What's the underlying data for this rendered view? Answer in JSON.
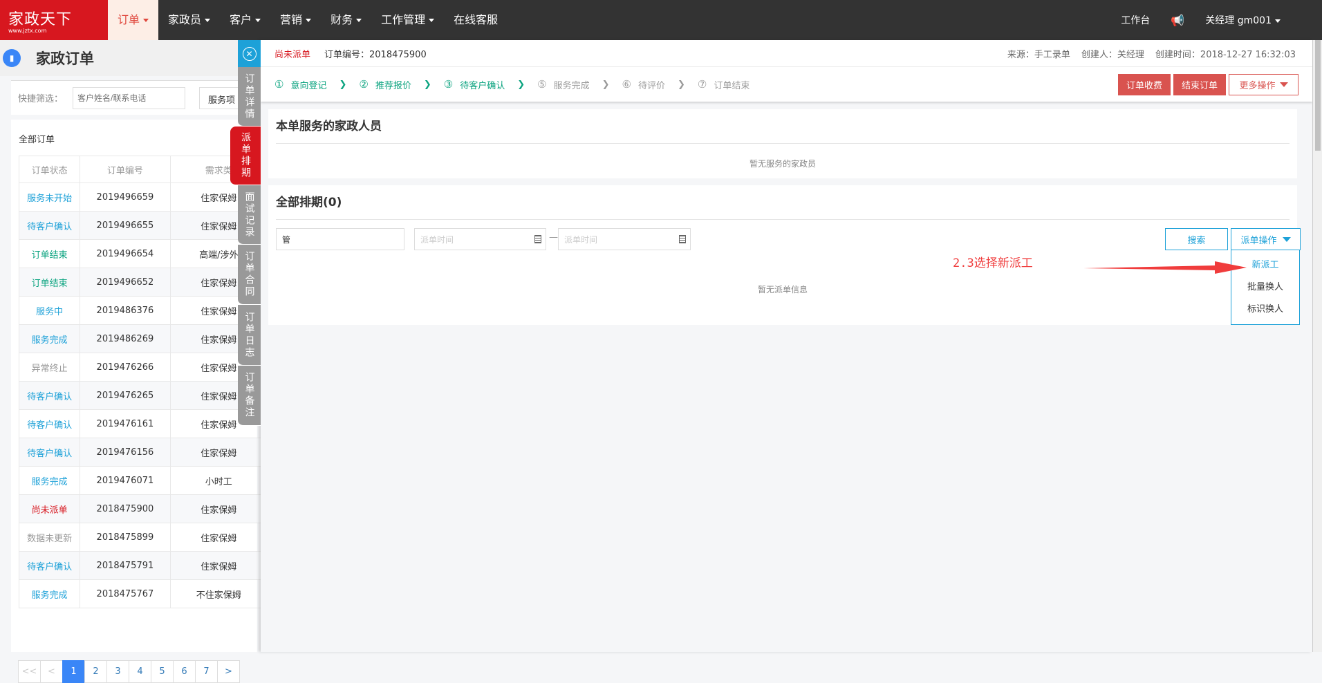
{
  "topnav": {
    "logo_text": "家政天下",
    "logo_url_text": "www.jztx.com",
    "items": [
      {
        "label": "订单",
        "active": true,
        "dropdown": true
      },
      {
        "label": "家政员",
        "dropdown": true
      },
      {
        "label": "客户",
        "dropdown": true
      },
      {
        "label": "营销",
        "dropdown": true
      },
      {
        "label": "财务",
        "dropdown": true
      },
      {
        "label": "工作管理",
        "dropdown": true
      },
      {
        "label": "在线客服",
        "dropdown": false
      }
    ],
    "workbench": "工作台",
    "user": "关经理  gm001"
  },
  "left": {
    "title": "家政订单",
    "filter_label": "快捷筛选：",
    "filter_placeholder": "客户姓名/联系电话",
    "filter_select": "服务项",
    "card_title": "全部订单",
    "columns": [
      "订单状态",
      "订单编号",
      "需求类"
    ],
    "rows": [
      {
        "status": "服务未开始",
        "color": "#1da1d8",
        "no": "2019496659",
        "type": "住家保姆"
      },
      {
        "status": "待客户确认",
        "color": "#1da1d8",
        "no": "2019496655",
        "type": "住家保姆"
      },
      {
        "status": "订单结束",
        "color": "#0aa37f",
        "no": "2019496654",
        "type": "高端/涉外"
      },
      {
        "status": "订单结束",
        "color": "#0aa37f",
        "no": "2019496652",
        "type": "住家保姆"
      },
      {
        "status": "服务中",
        "color": "#1da1d8",
        "no": "2019486376",
        "type": "住家保姆"
      },
      {
        "status": "服务完成",
        "color": "#1da1d8",
        "no": "2019486269",
        "type": "住家保姆"
      },
      {
        "status": "异常终止",
        "color": "#999999",
        "no": "2019476266",
        "type": "住家保姆"
      },
      {
        "status": "待客户确认",
        "color": "#1da1d8",
        "no": "2019476265",
        "type": "住家保姆"
      },
      {
        "status": "待客户确认",
        "color": "#1da1d8",
        "no": "2019476161",
        "type": "住家保姆"
      },
      {
        "status": "待客户确认",
        "color": "#1da1d8",
        "no": "2019476156",
        "type": "住家保姆"
      },
      {
        "status": "服务完成",
        "color": "#1da1d8",
        "no": "2019476071",
        "type": "小时工"
      },
      {
        "status": "尚未派单",
        "color": "#d7171f",
        "no": "2018475900",
        "type": "住家保姆"
      },
      {
        "status": "数据未更新",
        "color": "#999999",
        "no": "2018475899",
        "type": "住家保姆"
      },
      {
        "status": "待客户确认",
        "color": "#1da1d8",
        "no": "2018475791",
        "type": "住家保姆"
      },
      {
        "status": "服务完成",
        "color": "#1da1d8",
        "no": "2018475767",
        "type": "不住家保姆"
      }
    ],
    "pagination": [
      "<<",
      "<",
      "1",
      "2",
      "3",
      "4",
      "5",
      "6",
      "7",
      ">"
    ],
    "current_page": "1"
  },
  "vtabs": [
    {
      "label": "订单详情"
    },
    {
      "label": "派单排期",
      "active": true
    },
    {
      "label": "面试记录"
    },
    {
      "label": "订单合同"
    },
    {
      "label": "订单日志"
    },
    {
      "label": "订单备注"
    }
  ],
  "order": {
    "status": "尚未派单",
    "number": "订单编号：2018475900",
    "source": "来源：手工录单",
    "creator": "创建人：关经理",
    "created": "创建时间：2018-12-27 16:32:03",
    "steps": [
      {
        "num": "①",
        "label": "意向登记",
        "done": true
      },
      {
        "num": "②",
        "label": "推荐报价",
        "done": true
      },
      {
        "num": "③",
        "label": "待客户确认",
        "done": true
      },
      {
        "num": "⑤",
        "label": "服务完成",
        "done": false
      },
      {
        "num": "⑥",
        "label": "待评价",
        "done": false
      },
      {
        "num": "⑦",
        "label": "订单结束",
        "done": false
      }
    ],
    "btn_charge": "订单收费",
    "btn_end": "结束订单",
    "btn_more": "更多操作"
  },
  "staff_card": {
    "title": "本单服务的家政人员",
    "empty": "暂无服务的家政员"
  },
  "schedule_card": {
    "title": "全部排期(0)",
    "keyword_value": "管",
    "date_placeholder": "派单时间",
    "dash": "—",
    "search": "搜索",
    "ops": "派单操作",
    "ops_menu": [
      "新派工",
      "批量换人",
      "标识换人"
    ],
    "empty": "暂无派单信息"
  },
  "annotation": "2.3选择新派工",
  "colors": {
    "brand": "#d7171f",
    "accent": "#1da1d8",
    "done": "#0aa37f",
    "danger": "#d9534f"
  }
}
